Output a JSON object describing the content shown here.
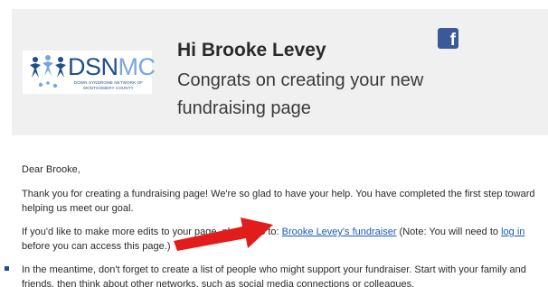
{
  "header": {
    "greeting": "Hi Brooke Levey",
    "subtitle": "Congrats on creating your new fundraising page",
    "facebook_icon": "facebook-icon",
    "colors": {
      "header_bg": "#f0f0f0",
      "facebook": "#3b5998"
    }
  },
  "logo": {
    "name_part1": "DSN",
    "name_part2": "MC",
    "tagline": "DOWN SYNDROME NETWORK OF MONTGOMERY COUNTY",
    "colors": {
      "primary": "#1f4e8c",
      "secondary": "#7aa7d8"
    }
  },
  "body": {
    "salutation": "Dear Brooke,",
    "para1": "Thank you for creating a fundraising page! We're so glad to have your help. You have completed the first step toward helping us meet our goal.",
    "para2_before": "If you'd like to make more edits to your page, please go to: ",
    "fundraiser_link": "Brooke Levey's fundraiser",
    "para2_middle": " (Note: You will need to ",
    "login_link": "log in",
    "para2_after": " before you can access this page.)",
    "para3": "In the meantime, don't forget to create a list of people who might support your fundraiser. Start with your family and friends, then think about other networks, such as social media connections or colleagues.",
    "link_color": "#1a5bb8"
  },
  "annotation": {
    "arrow_icon": "red-arrow-icon",
    "color": "#e21b1b"
  }
}
